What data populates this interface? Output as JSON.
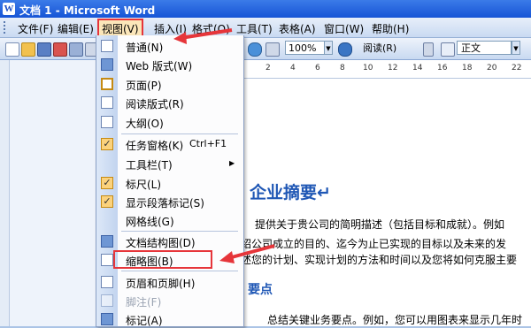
{
  "window": {
    "title": "文档 1 - Microsoft Word",
    "app_icon": "W"
  },
  "menubar": {
    "items": [
      "文件(F)",
      "编辑(E)",
      "视图(V)",
      "插入(I)",
      "格式(O)",
      "工具(T)",
      "表格(A)",
      "窗口(W)",
      "帮助(H)"
    ]
  },
  "toolbar": {
    "zoom": "100%",
    "read_label": "阅读(R)",
    "style": "正文"
  },
  "view_menu": {
    "items": [
      {
        "label": "普通(N)",
        "icon": "normal-view-icon"
      },
      {
        "label": "Web 版式(W)",
        "icon": "web-layout-icon"
      },
      {
        "label": "页面(P)",
        "icon": "print-layout-icon",
        "checked": true
      },
      {
        "label": "阅读版式(R)",
        "icon": "reading-layout-icon"
      },
      {
        "label": "大纲(O)",
        "icon": "outline-view-icon"
      },
      {
        "label": "任务窗格(K)",
        "shortcut": "Ctrl+F1",
        "icon": "check-icon",
        "checked": true
      },
      {
        "label": "工具栏(T)",
        "submenu": true
      },
      {
        "label": "标尺(L)",
        "icon": "check-icon",
        "checked": true
      },
      {
        "label": "显示段落标记(S)",
        "icon": "check-icon",
        "checked": true
      },
      {
        "label": "网格线(G)",
        "icon": "gridlines-icon"
      },
      {
        "label": "文档结构图(D)",
        "icon": "document-map-icon"
      },
      {
        "label": "缩略图(B)",
        "icon": "thumbnails-icon"
      },
      {
        "label": "页眉和页脚(H)",
        "icon": "header-footer-icon"
      },
      {
        "label": "脚注(F)",
        "disabled": true
      },
      {
        "label": "标记(A)",
        "icon": "markup-icon"
      }
    ]
  },
  "document": {
    "ruler_numbers": [
      "2",
      "4",
      "6",
      "8",
      "10",
      "12",
      "14",
      "16",
      "18",
      "20",
      "22"
    ],
    "heading1": "企业摘要↵",
    "para1_line1": "提供关于贵公司的简明描述（包括目标和成就）。例如",
    "para1_line2": "绍公司成立的目的、迄今为止已实现的目标以及未来的发",
    "para1_line3": "述您的计划、实现计划的方法和时间以及您将如何克服主要",
    "heading2": "要点",
    "para2_line1": "总结关键业务要点。例如，您可以用图表来显示几年时"
  }
}
